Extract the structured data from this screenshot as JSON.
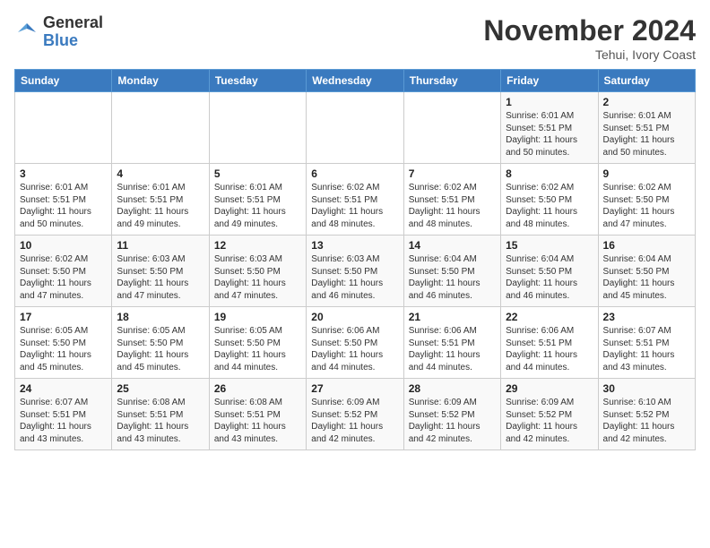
{
  "header": {
    "logo_general": "General",
    "logo_blue": "Blue",
    "month_title": "November 2024",
    "location": "Tehui, Ivory Coast"
  },
  "weekdays": [
    "Sunday",
    "Monday",
    "Tuesday",
    "Wednesday",
    "Thursday",
    "Friday",
    "Saturday"
  ],
  "weeks": [
    [
      {
        "day": "",
        "sunrise": "",
        "sunset": "",
        "daylight": ""
      },
      {
        "day": "",
        "sunrise": "",
        "sunset": "",
        "daylight": ""
      },
      {
        "day": "",
        "sunrise": "",
        "sunset": "",
        "daylight": ""
      },
      {
        "day": "",
        "sunrise": "",
        "sunset": "",
        "daylight": ""
      },
      {
        "day": "",
        "sunrise": "",
        "sunset": "",
        "daylight": ""
      },
      {
        "day": "1",
        "sunrise": "Sunrise: 6:01 AM",
        "sunset": "Sunset: 5:51 PM",
        "daylight": "Daylight: 11 hours and 50 minutes."
      },
      {
        "day": "2",
        "sunrise": "Sunrise: 6:01 AM",
        "sunset": "Sunset: 5:51 PM",
        "daylight": "Daylight: 11 hours and 50 minutes."
      }
    ],
    [
      {
        "day": "3",
        "sunrise": "Sunrise: 6:01 AM",
        "sunset": "Sunset: 5:51 PM",
        "daylight": "Daylight: 11 hours and 50 minutes."
      },
      {
        "day": "4",
        "sunrise": "Sunrise: 6:01 AM",
        "sunset": "Sunset: 5:51 PM",
        "daylight": "Daylight: 11 hours and 49 minutes."
      },
      {
        "day": "5",
        "sunrise": "Sunrise: 6:01 AM",
        "sunset": "Sunset: 5:51 PM",
        "daylight": "Daylight: 11 hours and 49 minutes."
      },
      {
        "day": "6",
        "sunrise": "Sunrise: 6:02 AM",
        "sunset": "Sunset: 5:51 PM",
        "daylight": "Daylight: 11 hours and 48 minutes."
      },
      {
        "day": "7",
        "sunrise": "Sunrise: 6:02 AM",
        "sunset": "Sunset: 5:51 PM",
        "daylight": "Daylight: 11 hours and 48 minutes."
      },
      {
        "day": "8",
        "sunrise": "Sunrise: 6:02 AM",
        "sunset": "Sunset: 5:50 PM",
        "daylight": "Daylight: 11 hours and 48 minutes."
      },
      {
        "day": "9",
        "sunrise": "Sunrise: 6:02 AM",
        "sunset": "Sunset: 5:50 PM",
        "daylight": "Daylight: 11 hours and 47 minutes."
      }
    ],
    [
      {
        "day": "10",
        "sunrise": "Sunrise: 6:02 AM",
        "sunset": "Sunset: 5:50 PM",
        "daylight": "Daylight: 11 hours and 47 minutes."
      },
      {
        "day": "11",
        "sunrise": "Sunrise: 6:03 AM",
        "sunset": "Sunset: 5:50 PM",
        "daylight": "Daylight: 11 hours and 47 minutes."
      },
      {
        "day": "12",
        "sunrise": "Sunrise: 6:03 AM",
        "sunset": "Sunset: 5:50 PM",
        "daylight": "Daylight: 11 hours and 47 minutes."
      },
      {
        "day": "13",
        "sunrise": "Sunrise: 6:03 AM",
        "sunset": "Sunset: 5:50 PM",
        "daylight": "Daylight: 11 hours and 46 minutes."
      },
      {
        "day": "14",
        "sunrise": "Sunrise: 6:04 AM",
        "sunset": "Sunset: 5:50 PM",
        "daylight": "Daylight: 11 hours and 46 minutes."
      },
      {
        "day": "15",
        "sunrise": "Sunrise: 6:04 AM",
        "sunset": "Sunset: 5:50 PM",
        "daylight": "Daylight: 11 hours and 46 minutes."
      },
      {
        "day": "16",
        "sunrise": "Sunrise: 6:04 AM",
        "sunset": "Sunset: 5:50 PM",
        "daylight": "Daylight: 11 hours and 45 minutes."
      }
    ],
    [
      {
        "day": "17",
        "sunrise": "Sunrise: 6:05 AM",
        "sunset": "Sunset: 5:50 PM",
        "daylight": "Daylight: 11 hours and 45 minutes."
      },
      {
        "day": "18",
        "sunrise": "Sunrise: 6:05 AM",
        "sunset": "Sunset: 5:50 PM",
        "daylight": "Daylight: 11 hours and 45 minutes."
      },
      {
        "day": "19",
        "sunrise": "Sunrise: 6:05 AM",
        "sunset": "Sunset: 5:50 PM",
        "daylight": "Daylight: 11 hours and 44 minutes."
      },
      {
        "day": "20",
        "sunrise": "Sunrise: 6:06 AM",
        "sunset": "Sunset: 5:50 PM",
        "daylight": "Daylight: 11 hours and 44 minutes."
      },
      {
        "day": "21",
        "sunrise": "Sunrise: 6:06 AM",
        "sunset": "Sunset: 5:51 PM",
        "daylight": "Daylight: 11 hours and 44 minutes."
      },
      {
        "day": "22",
        "sunrise": "Sunrise: 6:06 AM",
        "sunset": "Sunset: 5:51 PM",
        "daylight": "Daylight: 11 hours and 44 minutes."
      },
      {
        "day": "23",
        "sunrise": "Sunrise: 6:07 AM",
        "sunset": "Sunset: 5:51 PM",
        "daylight": "Daylight: 11 hours and 43 minutes."
      }
    ],
    [
      {
        "day": "24",
        "sunrise": "Sunrise: 6:07 AM",
        "sunset": "Sunset: 5:51 PM",
        "daylight": "Daylight: 11 hours and 43 minutes."
      },
      {
        "day": "25",
        "sunrise": "Sunrise: 6:08 AM",
        "sunset": "Sunset: 5:51 PM",
        "daylight": "Daylight: 11 hours and 43 minutes."
      },
      {
        "day": "26",
        "sunrise": "Sunrise: 6:08 AM",
        "sunset": "Sunset: 5:51 PM",
        "daylight": "Daylight: 11 hours and 43 minutes."
      },
      {
        "day": "27",
        "sunrise": "Sunrise: 6:09 AM",
        "sunset": "Sunset: 5:52 PM",
        "daylight": "Daylight: 11 hours and 42 minutes."
      },
      {
        "day": "28",
        "sunrise": "Sunrise: 6:09 AM",
        "sunset": "Sunset: 5:52 PM",
        "daylight": "Daylight: 11 hours and 42 minutes."
      },
      {
        "day": "29",
        "sunrise": "Sunrise: 6:09 AM",
        "sunset": "Sunset: 5:52 PM",
        "daylight": "Daylight: 11 hours and 42 minutes."
      },
      {
        "day": "30",
        "sunrise": "Sunrise: 6:10 AM",
        "sunset": "Sunset: 5:52 PM",
        "daylight": "Daylight: 11 hours and 42 minutes."
      }
    ]
  ]
}
